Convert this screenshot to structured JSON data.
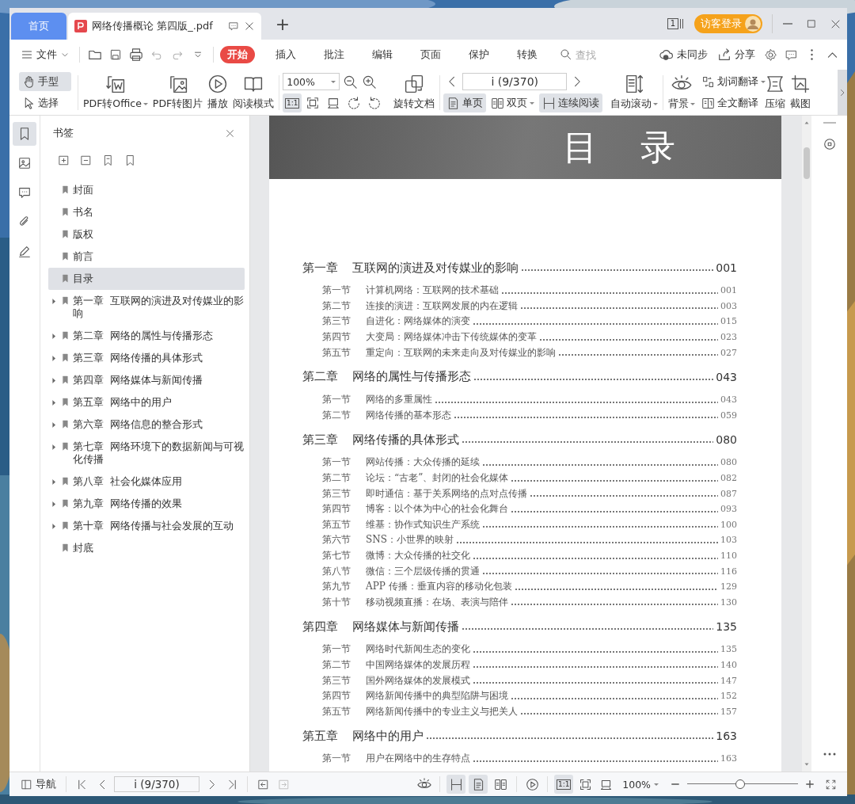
{
  "tabs": [
    {
      "label": "首页",
      "kind": "home",
      "selected": false
    },
    {
      "label": "网络传播概论 第四版_.pdf",
      "kind": "document",
      "selected": true
    }
  ],
  "new_tab": "+",
  "title_bar": {
    "window_count": "1",
    "login": "访客登录"
  },
  "menu": {
    "file": "文件",
    "items": [
      {
        "label": "开始",
        "selected": true
      },
      {
        "label": "插入",
        "selected": false
      },
      {
        "label": "批注",
        "selected": false
      },
      {
        "label": "编辑",
        "selected": false
      },
      {
        "label": "页面",
        "selected": false
      },
      {
        "label": "保护",
        "selected": false
      },
      {
        "label": "转换",
        "selected": false
      }
    ],
    "search_placeholder": "查找",
    "sync": "未同步",
    "share": "分享"
  },
  "toolbar": {
    "pointer_tools": [
      {
        "label": "手型",
        "selected": true
      },
      {
        "label": "选择",
        "selected": false
      }
    ],
    "convert_tools": [
      {
        "label": "PDF转Office",
        "dropdown": true
      },
      {
        "label": "PDF转图片",
        "dropdown": false
      },
      {
        "label": "播放",
        "dropdown": false
      },
      {
        "label": "阅读模式",
        "dropdown": false
      }
    ],
    "zoom": "100%",
    "view_tools": [
      {
        "label": "1:1",
        "selected": true
      },
      {
        "selected": false
      },
      {
        "selected": false
      },
      {
        "selected": false
      },
      {
        "selected": false
      }
    ],
    "rotate_doc": "旋转文档",
    "page_field": "i (9/370)",
    "view_modes": [
      {
        "label": "单页",
        "selected": true,
        "dropdown": false
      },
      {
        "label": "双页",
        "selected": false,
        "dropdown": true
      },
      {
        "label": "连续阅读",
        "selected": true,
        "dropdown": false
      }
    ],
    "auto_scroll": "自动滚动",
    "background": "背景",
    "translate_tools": [
      {
        "label": "划词翻译",
        "dropdown": true
      },
      {
        "label": "全文翻译",
        "dropdown": false
      }
    ],
    "compress": "压缩",
    "screenshot": "截图"
  },
  "sidebar": {
    "title": "书签",
    "items": [
      {
        "label": "封面",
        "expandable": false,
        "selected": false
      },
      {
        "label": "书名",
        "expandable": false,
        "selected": false
      },
      {
        "label": "版权",
        "expandable": false,
        "selected": false
      },
      {
        "label": "前言",
        "expandable": false,
        "selected": false
      },
      {
        "label": "目录",
        "expandable": false,
        "selected": true
      },
      {
        "label": "第一章 互联网的演进及对传媒业的影响",
        "expandable": true,
        "selected": false
      },
      {
        "label": "第二章 网络的属性与传播形态",
        "expandable": true,
        "selected": false
      },
      {
        "label": "第三章 网络传播的具体形式",
        "expandable": true,
        "selected": false
      },
      {
        "label": "第四章 网络媒体与新闻传播",
        "expandable": true,
        "selected": false
      },
      {
        "label": "第五章 网络中的用户",
        "expandable": true,
        "selected": false
      },
      {
        "label": "第六章 网络信息的整合形式",
        "expandable": true,
        "selected": false
      },
      {
        "label": "第七章 网络环境下的数据新闻与可视化传播",
        "expandable": true,
        "selected": false
      },
      {
        "label": "第八章 社会化媒体应用",
        "expandable": true,
        "selected": false
      },
      {
        "label": "第九章 网络传播的效果",
        "expandable": true,
        "selected": false
      },
      {
        "label": "第十章 网络传播与社会发展的互动",
        "expandable": true,
        "selected": false
      },
      {
        "label": "封底",
        "expandable": false,
        "selected": false
      }
    ]
  },
  "document": {
    "heading": "目 录",
    "toc": [
      {
        "kind": "chapter",
        "number": "第一章",
        "title": "互联网的演进及对传媒业的影响",
        "page": "001"
      },
      {
        "kind": "section",
        "number": "第一节",
        "title": "计算机网络：互联网的技术基础",
        "page": "001"
      },
      {
        "kind": "section",
        "number": "第二节",
        "title": "连接的演进：互联网发展的内在逻辑",
        "page": "003"
      },
      {
        "kind": "section",
        "number": "第三节",
        "title": "自进化：网络媒体的演变",
        "page": "015"
      },
      {
        "kind": "section",
        "number": "第四节",
        "title": "大变局：网络媒体冲击下传统媒体的变革",
        "page": "023"
      },
      {
        "kind": "section",
        "number": "第五节",
        "title": "重定向：互联网的未来走向及对传媒业的影响",
        "page": "027"
      },
      {
        "kind": "chapter",
        "number": "第二章",
        "title": "网络的属性与传播形态",
        "page": "043"
      },
      {
        "kind": "section",
        "number": "第一节",
        "title": "网络的多重属性",
        "page": "043"
      },
      {
        "kind": "section",
        "number": "第二节",
        "title": "网络传播的基本形态",
        "page": "059"
      },
      {
        "kind": "chapter",
        "number": "第三章",
        "title": "网络传播的具体形式",
        "page": "080"
      },
      {
        "kind": "section",
        "number": "第一节",
        "title": "网站传播：大众传播的延续",
        "page": "080"
      },
      {
        "kind": "section",
        "number": "第二节",
        "title": "论坛：“古老”、封闭的社会化媒体",
        "page": "082"
      },
      {
        "kind": "section",
        "number": "第三节",
        "title": "即时通信：基于关系网络的点对点传播",
        "page": "087"
      },
      {
        "kind": "section",
        "number": "第四节",
        "title": "博客：以个体为中心的社会化舞台",
        "page": "093"
      },
      {
        "kind": "section",
        "number": "第五节",
        "title": "维基：协作式知识生产系统",
        "page": "100"
      },
      {
        "kind": "section",
        "number": "第六节",
        "title": "SNS：小世界的映射",
        "page": "103"
      },
      {
        "kind": "section",
        "number": "第七节",
        "title": "微博：大众传播的社交化",
        "page": "110"
      },
      {
        "kind": "section",
        "number": "第八节",
        "title": "微信：三个层级传播的贯通",
        "page": "116"
      },
      {
        "kind": "section",
        "number": "第九节",
        "title": "APP 传播：垂直内容的移动化包装",
        "page": "129"
      },
      {
        "kind": "section",
        "number": "第十节",
        "title": "移动视频直播：在场、表演与陪伴",
        "page": "130"
      },
      {
        "kind": "chapter",
        "number": "第四章",
        "title": "网络媒体与新闻传播",
        "page": "135"
      },
      {
        "kind": "section",
        "number": "第一节",
        "title": "网络时代新闻生态的变化",
        "page": "135"
      },
      {
        "kind": "section",
        "number": "第二节",
        "title": "中国网络媒体的发展历程",
        "page": "140"
      },
      {
        "kind": "section",
        "number": "第三节",
        "title": "国外网络媒体的发展模式",
        "page": "147"
      },
      {
        "kind": "section",
        "number": "第四节",
        "title": "网络新闻传播中的典型陷阱与困境",
        "page": "152"
      },
      {
        "kind": "section",
        "number": "第五节",
        "title": "网络新闻传播中的专业主义与把关人",
        "page": "157"
      },
      {
        "kind": "chapter",
        "number": "第五章",
        "title": "网络中的用户",
        "page": "163"
      },
      {
        "kind": "section",
        "number": "第一节",
        "title": "用户在网络中的生存特点",
        "page": "163"
      }
    ]
  },
  "status_bar": {
    "nav": "导航",
    "page_field": "i (9/370)",
    "view_modes": [
      {
        "selected": true
      },
      {
        "selected": true
      },
      {
        "selected": false
      }
    ],
    "actual_size": {
      "label": "1:1",
      "selected": true
    },
    "zoom": "100%",
    "zoom_slider": {
      "level": 0.48
    }
  }
}
